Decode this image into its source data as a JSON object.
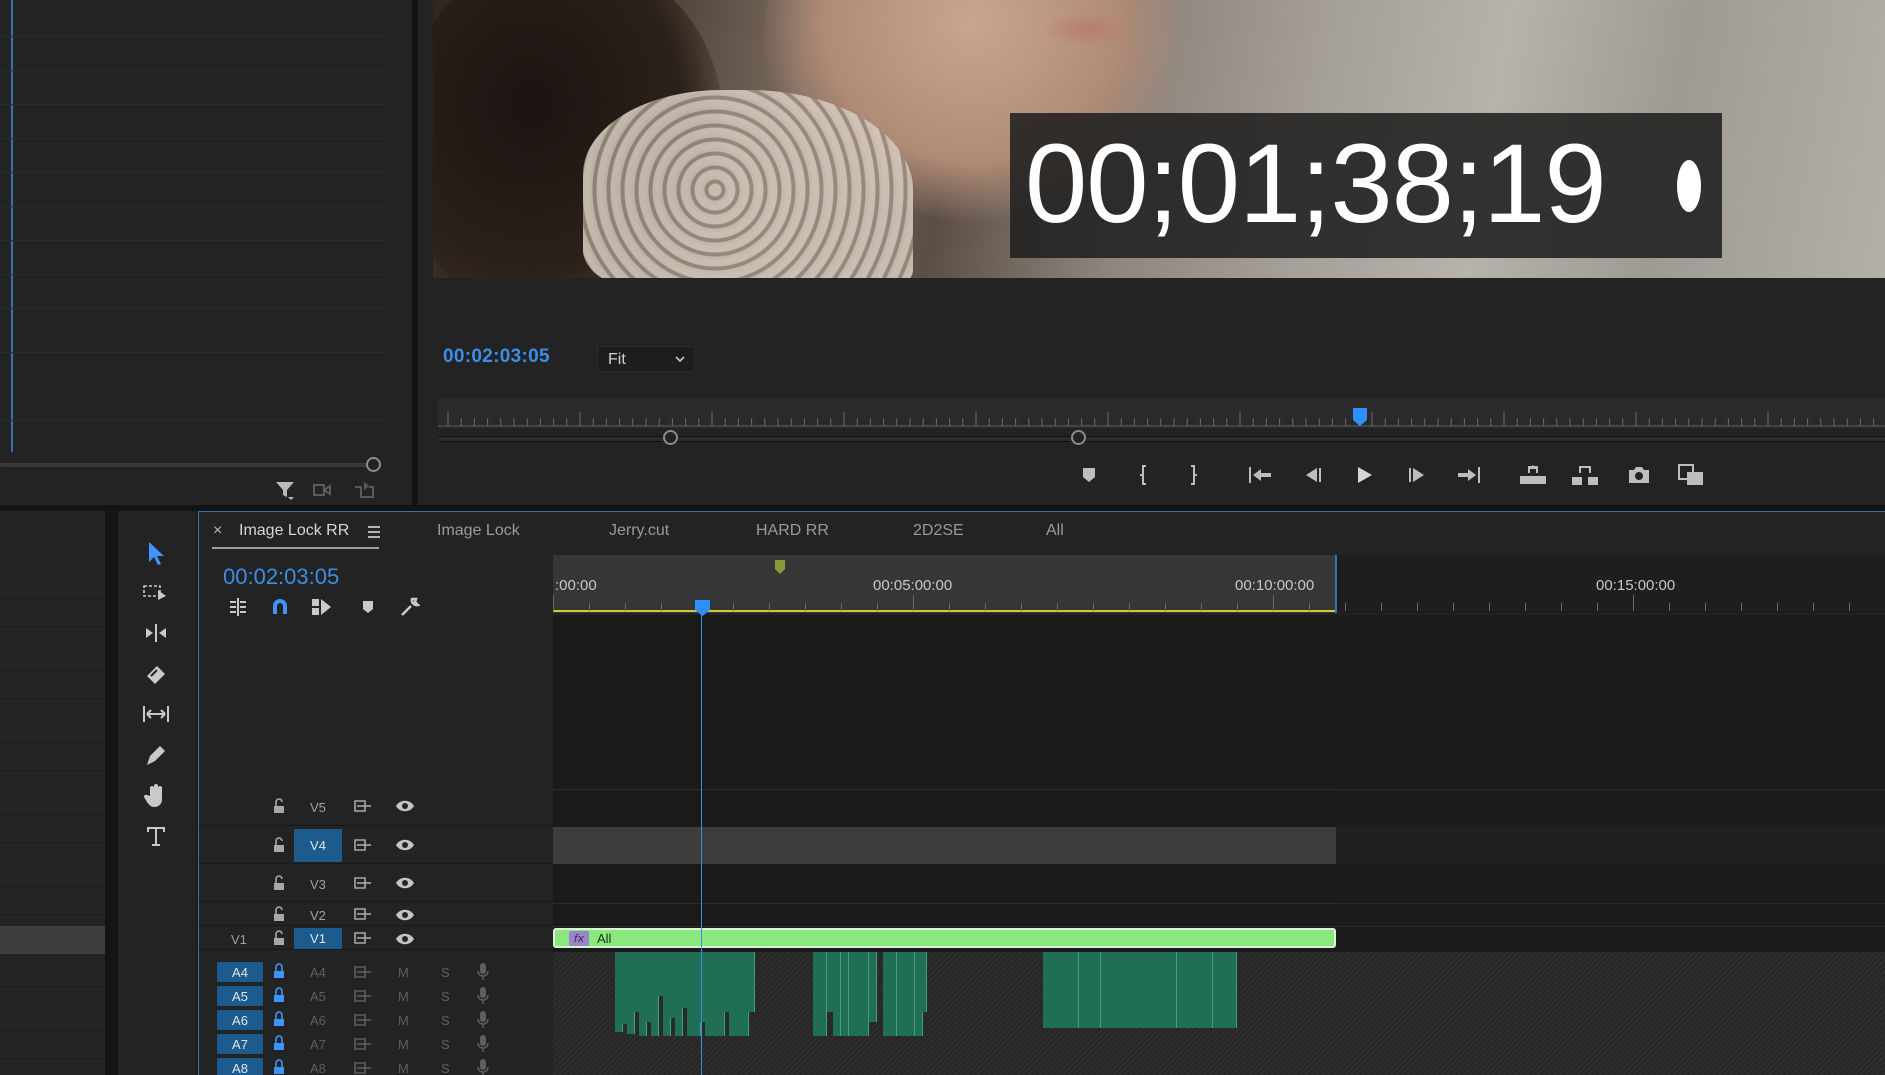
{
  "colors": {
    "accent_blue": "#3a8ee6",
    "patch_blue": "#1d5b8e",
    "clip_green": "#8be87f",
    "audio_green": "#1f6e55",
    "work_area_yellow": "#d7c731",
    "marker_olive": "#8a9a3a"
  },
  "program_monitor": {
    "overlay_timecode": "00;01;38;19",
    "playhead_timecode": "00:02:03:05",
    "zoom_select": {
      "value": "Fit",
      "icon": "chevron-down-icon"
    },
    "transport_controls": [
      {
        "name": "add-marker-button",
        "icon": "marker-icon"
      },
      {
        "name": "mark-in-button",
        "icon": "mark-in-icon"
      },
      {
        "name": "mark-out-button",
        "icon": "mark-out-icon"
      },
      {
        "name": "go-to-in-button",
        "icon": "go-to-in-icon"
      },
      {
        "name": "step-back-button",
        "icon": "step-back-icon"
      },
      {
        "name": "play-button",
        "icon": "play-icon"
      },
      {
        "name": "step-forward-button",
        "icon": "step-forward-icon"
      },
      {
        "name": "go-to-out-button",
        "icon": "go-to-out-icon"
      },
      {
        "name": "lift-button",
        "icon": "lift-icon"
      },
      {
        "name": "extract-button",
        "icon": "extract-icon"
      },
      {
        "name": "export-frame-button",
        "icon": "camera-icon"
      },
      {
        "name": "comparison-view-button",
        "icon": "comparison-icon"
      }
    ]
  },
  "project_panel": {
    "toolbar_icons": [
      "filter-icon",
      "automate-to-sequence-icon",
      "new-item-icon"
    ]
  },
  "tools": [
    "selection-tool-icon",
    "track-select-tool-icon",
    "ripple-edit-tool-icon",
    "razor-tool-icon",
    "slip-tool-icon",
    "pen-tool-icon",
    "hand-tool-icon",
    "type-tool-icon"
  ],
  "timeline": {
    "close_glyph": "×",
    "menu_icon": "hamburger-menu-icon",
    "tabs": [
      "Image Lock RR",
      "Image Lock",
      "Jerry.cut",
      "HARD RR",
      "2D2SE",
      "All"
    ],
    "active_tab": "Image Lock RR",
    "timecode": "00:02:03:05",
    "toolbar_icons": [
      "insert-nest-icon",
      "snap-icon",
      "linked-selection-icon",
      "add-marker-icon",
      "settings-wrench-icon"
    ],
    "ruler_labels": [
      ":00:00",
      "00:05:00:00",
      "00:10:00:00",
      "00:15:00:00"
    ],
    "video_tracks": [
      {
        "target": "",
        "source": "V5",
        "patched": false
      },
      {
        "target": "",
        "source": "V4",
        "patched": true
      },
      {
        "target": "",
        "source": "V3",
        "patched": false
      },
      {
        "target": "",
        "source": "V2",
        "patched": false
      },
      {
        "target": "V1",
        "source": "V1",
        "patched": true
      }
    ],
    "audio_tracks": [
      {
        "target": "A4",
        "source": "A4",
        "mute": "M",
        "solo": "S"
      },
      {
        "target": "A5",
        "source": "A5",
        "mute": "M",
        "solo": "S"
      },
      {
        "target": "A6",
        "source": "A6",
        "mute": "M",
        "solo": "S"
      },
      {
        "target": "A7",
        "source": "A7",
        "mute": "M",
        "solo": "S"
      },
      {
        "target": "A8",
        "source": "A8",
        "mute": "M",
        "solo": "S"
      }
    ],
    "v1_clip": {
      "name": "All",
      "fx_badge": "fx"
    }
  }
}
